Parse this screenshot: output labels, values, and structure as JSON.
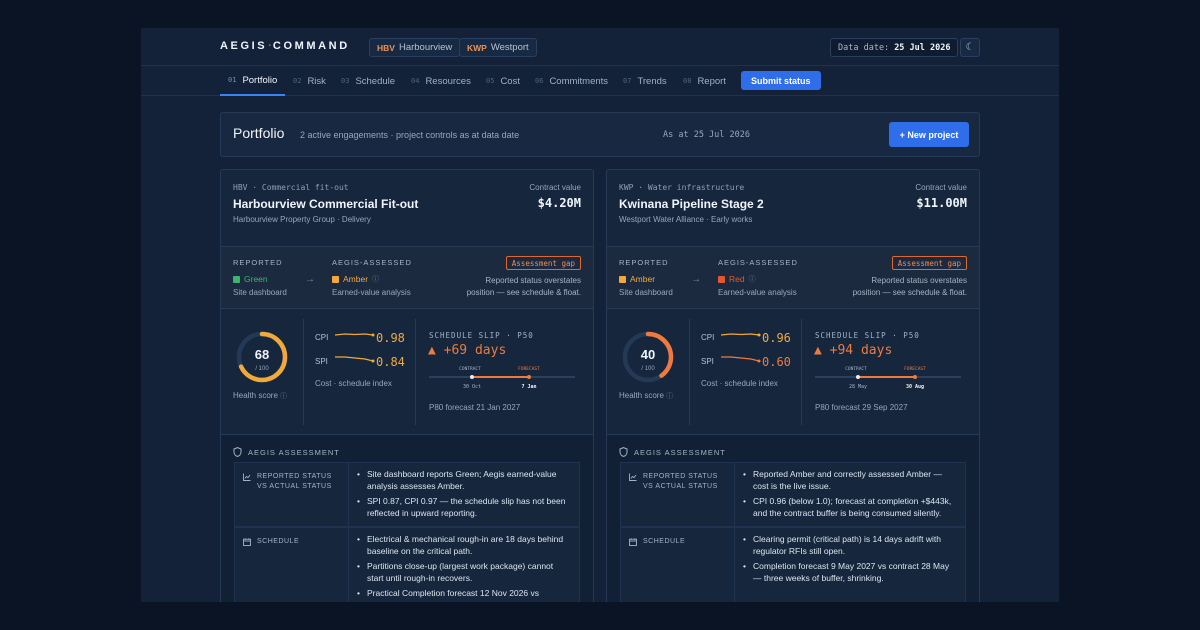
{
  "header": {
    "brand_left": "AEGIS",
    "brand_sep": "·",
    "brand_right": "COMMAND",
    "engagements": [
      {
        "code": "HBV",
        "name": "Harbourview"
      },
      {
        "code": "KWP",
        "name": "Westport"
      }
    ],
    "data_date_label": "Data date:",
    "data_date": "25 Jul 2026",
    "theme_icon": "moon-icon"
  },
  "nav": {
    "tabs": [
      {
        "num": "01",
        "label": "Portfolio",
        "active": true
      },
      {
        "num": "02",
        "label": "Risk"
      },
      {
        "num": "03",
        "label": "Schedule"
      },
      {
        "num": "04",
        "label": "Resources"
      },
      {
        "num": "05",
        "label": "Cost"
      },
      {
        "num": "06",
        "label": "Commitments"
      },
      {
        "num": "07",
        "label": "Trends"
      },
      {
        "num": "08",
        "label": "Report"
      }
    ],
    "submit_label": "Submit status"
  },
  "portfolio": {
    "title": "Portfolio",
    "subtitle": "2 active engagements · project controls as at data date",
    "as_at": "As at 25 Jul 2026",
    "new_project_label": "+ New project"
  },
  "labels": {
    "contract_value": "Contract value",
    "reported": "REPORTED",
    "assessed": "AEGIS-ASSESSED",
    "gap_badge": "Assessment gap",
    "health_score": "Health score",
    "cpi": "CPI",
    "spi": "SPI",
    "index_caption": "Cost · schedule index",
    "slip_label": "SCHEDULE SLIP · P50",
    "contract": "CONTRACT",
    "forecast": "FORECAST",
    "assessment_title": "AEGIS ASSESSMENT",
    "row_status": "REPORTED STATUS VS ACTUAL STATUS",
    "row_schedule": "SCHEDULE",
    "score_den": "/ 100"
  },
  "colors": {
    "green": "#3fb36c",
    "amber": "#f2a93b",
    "red": "#e4572e",
    "orange": "#f07a3e",
    "accent": "#2f6ee8"
  },
  "projects": [
    {
      "kicker_code": "HBV",
      "kicker_type": "Commercial fit-out",
      "title": "Harbourview Commercial Fit-out",
      "client": "Harbourview Property Group · Delivery",
      "contract_value": "$4.20M",
      "reported_status": "Green",
      "reported_color": "#3fb36c",
      "reported_source": "Site dashboard",
      "assessed_status": "Amber",
      "assessed_color": "#f2a93b",
      "assessed_source": "Earned-value analysis",
      "gap_note_1": "Reported status overstates",
      "gap_note_2": "position — see schedule & float.",
      "health_score": "68",
      "health_value": 68,
      "health_color": "#f2a93b",
      "cpi": "0.98",
      "cpi_color": "#f2a93b",
      "spi": "0.84",
      "spi_color": "#f2a93b",
      "slip": "▲ +69 days",
      "contract_date": "30 Oct",
      "forecast_date": "7 Jan",
      "p80": "P80 forecast 21 Jan 2027",
      "status_bullets": [
        "Site dashboard reports Green; Aegis earned-value",
        "analysis assesses Amber.",
        "SPI 0.87, CPI 0.97 — the schedule slip has not been",
        "reflected in upward reporting."
      ],
      "schedule_bullets": [
        "Electrical & mechanical rough-in are 18 days behind",
        "baseline on the critical path.",
        "Partitions close-up (largest work package) cannot",
        "start until rough-in recovers.",
        "Practical Completion forecast 12 Nov 2026 vs"
      ]
    },
    {
      "kicker_code": "KWP",
      "kicker_type": "Water infrastructure",
      "title": "Kwinana Pipeline Stage 2",
      "client": "Westport Water Alliance · Early works",
      "contract_value": "$11.00M",
      "reported_status": "Amber",
      "reported_color": "#f2a93b",
      "reported_source": "Site dashboard",
      "assessed_status": "Red",
      "assessed_color": "#e4572e",
      "assessed_source": "Earned-value analysis",
      "gap_note_1": "Reported status overstates",
      "gap_note_2": "position — see schedule & float.",
      "health_score": "40",
      "health_value": 40,
      "health_color": "#f07a3e",
      "cpi": "0.96",
      "cpi_color": "#f2a93b",
      "spi": "0.60",
      "spi_color": "#f07a3e",
      "slip": "▲ +94 days",
      "contract_date": "28 May",
      "forecast_date": "30 Aug",
      "p80": "P80 forecast 29 Sep 2027",
      "status_bullets": [
        "Reported Amber and correctly assessed Amber —",
        "cost is the live issue.",
        "CPI 0.96 (below 1.0); forecast at completion +$443k,",
        "and the contract buffer is being consumed silently."
      ],
      "schedule_bullets": [
        "Clearing permit (critical path) is 14 days adrift with",
        "regulator RFIs still open.",
        "Completion forecast 9 May 2027 vs contract 28 May",
        "— three weeks of buffer, shrinking."
      ]
    }
  ]
}
